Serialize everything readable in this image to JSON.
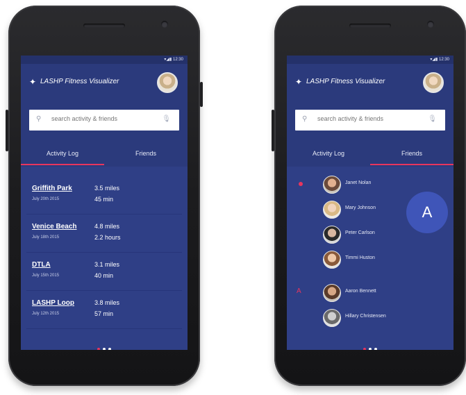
{
  "status_bar": {
    "time": "12:30"
  },
  "app": {
    "title": "LASHP Fitness Visualizer"
  },
  "search": {
    "placeholder": "search activity & friends"
  },
  "tabs": [
    {
      "label": "Activity Log"
    },
    {
      "label": "Friends"
    }
  ],
  "activity_log": [
    {
      "name": "Griffith Park",
      "date": "July 20th 2015",
      "distance": "3.5 miles",
      "duration": "45 min"
    },
    {
      "name": "Venice Beach",
      "date": "July 18th 2015",
      "distance": "4.8 miles",
      "duration": "2.2 hours"
    },
    {
      "name": "DTLA",
      "date": "July 15th 2015",
      "distance": "3.1 miles",
      "duration": "40 min"
    },
    {
      "name": "LASHP Loop",
      "date": "July 12th 2015",
      "distance": "3.8 miles",
      "duration": "57 min"
    }
  ],
  "friends": [
    {
      "name": "Janet Nolan"
    },
    {
      "name": "Mary Johnson"
    },
    {
      "name": "Peter Carlson"
    },
    {
      "name": "Timmi Huston"
    },
    {
      "name": "Aaron Bennett",
      "letter": "A"
    },
    {
      "name": "Hillary Christensen"
    }
  ],
  "fast_scroll_letter": "A",
  "colors": {
    "primary": "#2b3a7c",
    "content": "#2f3f86",
    "accent": "#e8355e"
  }
}
